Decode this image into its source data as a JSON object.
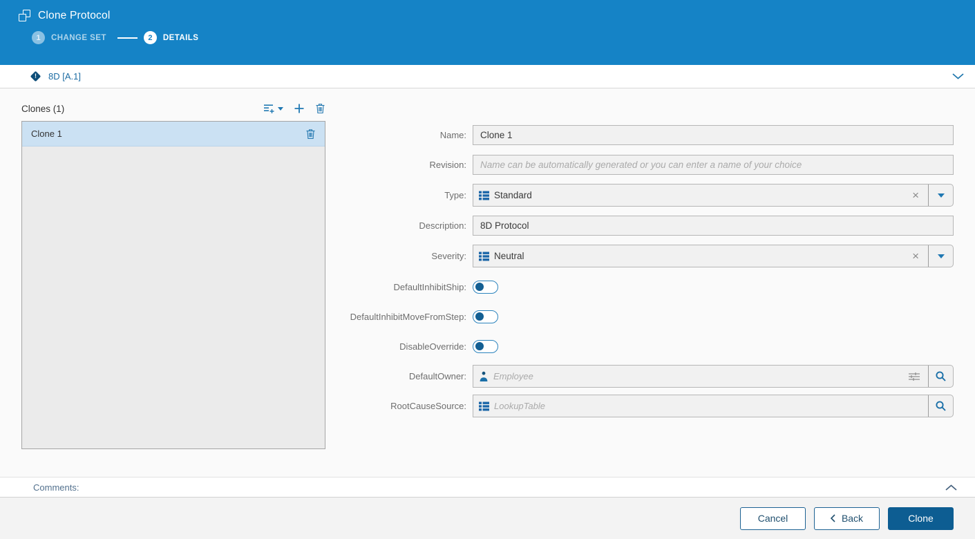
{
  "header": {
    "title": "Clone Protocol",
    "steps": [
      {
        "number": "1",
        "label": "CHANGE SET",
        "state": "done"
      },
      {
        "number": "2",
        "label": "DETAILS",
        "state": "active"
      }
    ]
  },
  "subheader": {
    "title": "8D [A.1]",
    "status_glyph": "!"
  },
  "clones_panel": {
    "title": "Clones (1)",
    "items": [
      {
        "name": "Clone 1",
        "selected": true
      }
    ]
  },
  "form": {
    "fields": {
      "name": {
        "label": "Name:",
        "value": "Clone 1"
      },
      "revision": {
        "label": "Revision:",
        "placeholder": "Name can be automatically generated or you can enter a name of your choice"
      },
      "type": {
        "label": "Type:",
        "value": "Standard"
      },
      "description": {
        "label": "Description:",
        "value": "8D Protocol"
      },
      "severity": {
        "label": "Severity:",
        "value": "Neutral"
      },
      "default_inhibit_ship": {
        "label": "DefaultInhibitShip:",
        "state": "off"
      },
      "default_inhibit_move_from_step": {
        "label": "DefaultInhibitMoveFromStep:",
        "state": "off"
      },
      "disable_override": {
        "label": "DisableOverride:",
        "state": "off"
      },
      "default_owner": {
        "label": "DefaultOwner:",
        "placeholder": "Employee"
      },
      "root_cause_source": {
        "label": "RootCauseSource:",
        "placeholder": "LookupTable"
      }
    }
  },
  "comments": {
    "label": "Comments:"
  },
  "footer": {
    "cancel_label": "Cancel",
    "back_label": "Back",
    "clone_label": "Clone"
  },
  "icons": {
    "clear_glyph": "×",
    "header_icon": "clone-icon",
    "status_icon": "alert-diamond-icon",
    "list_tools": [
      "add-from-list-icon",
      "add-icon",
      "delete-icon"
    ],
    "lookup_icon": "lookup-table-icon",
    "person_icon": "employee-icon",
    "search_icon": "magnifier-icon",
    "filter_icon": "sliders-icon"
  },
  "colors": {
    "header": "#1583c6",
    "accent": "#1e76ad",
    "primary_button": "#0d5d92",
    "selected_row": "#cbe1f3",
    "status_diamond": "#0e4e79"
  }
}
